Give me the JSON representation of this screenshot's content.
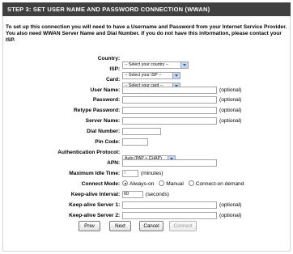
{
  "header": {
    "title": "STEP 3: SET USER NAME AND PASSWORD CONNECTION (WWAN)"
  },
  "intro": {
    "text": "To set up this connection you will need to have a Username and Password from your Internet Service Provider. You also need WWAN Server Name and Dial Number. If you do not have this information, please contact your ISP."
  },
  "form": {
    "country": {
      "label": "Country",
      "value": "-- Select your country --"
    },
    "isp": {
      "label": "ISP",
      "value": "-- Select your ISP --"
    },
    "card": {
      "label": "Card",
      "value": "-- Select your card --"
    },
    "user_name": {
      "label": "User Name",
      "value": "",
      "note": "(optional)"
    },
    "password": {
      "label": "Password",
      "value": "",
      "note": "(optional)"
    },
    "retype_password": {
      "label": "Retype Password",
      "value": "",
      "note": "(optional)"
    },
    "server_name": {
      "label": "Server Name",
      "value": "",
      "note": "(optional)"
    },
    "dial_number": {
      "label": "Dial Number",
      "value": ""
    },
    "pin_code": {
      "label": "Pin Code",
      "value": ""
    },
    "auth_protocol": {
      "label": "Authentication Protocol",
      "value": "Auto (PAP + CHAP)"
    },
    "apn": {
      "label": "APN",
      "value": ""
    },
    "max_idle_time": {
      "label": "Maximum Idle Time",
      "value": "0",
      "unit": "(minutes)"
    },
    "connect_mode": {
      "label": "Connect Mode",
      "options": [
        "Always-on",
        "Manual",
        "Connect-on demand"
      ],
      "selected": "Always-on"
    },
    "keepalive_interval": {
      "label": "Keep-alive Interval",
      "value": "60",
      "unit": "(seconds)"
    },
    "keepalive_server1": {
      "label": "Keep-alive Server 1",
      "value": "",
      "note": "(optional)"
    },
    "keepalive_server2": {
      "label": "Keep-alive Server 2",
      "value": "",
      "note": "(optional)"
    }
  },
  "buttons": {
    "prev": "Prev",
    "next": "Next",
    "cancel": "Cancel",
    "connect": "Connect"
  },
  "colors": {
    "header_bg": "#404040",
    "header_text": "#ffffff",
    "select_arrow": "#c9d7ee"
  }
}
